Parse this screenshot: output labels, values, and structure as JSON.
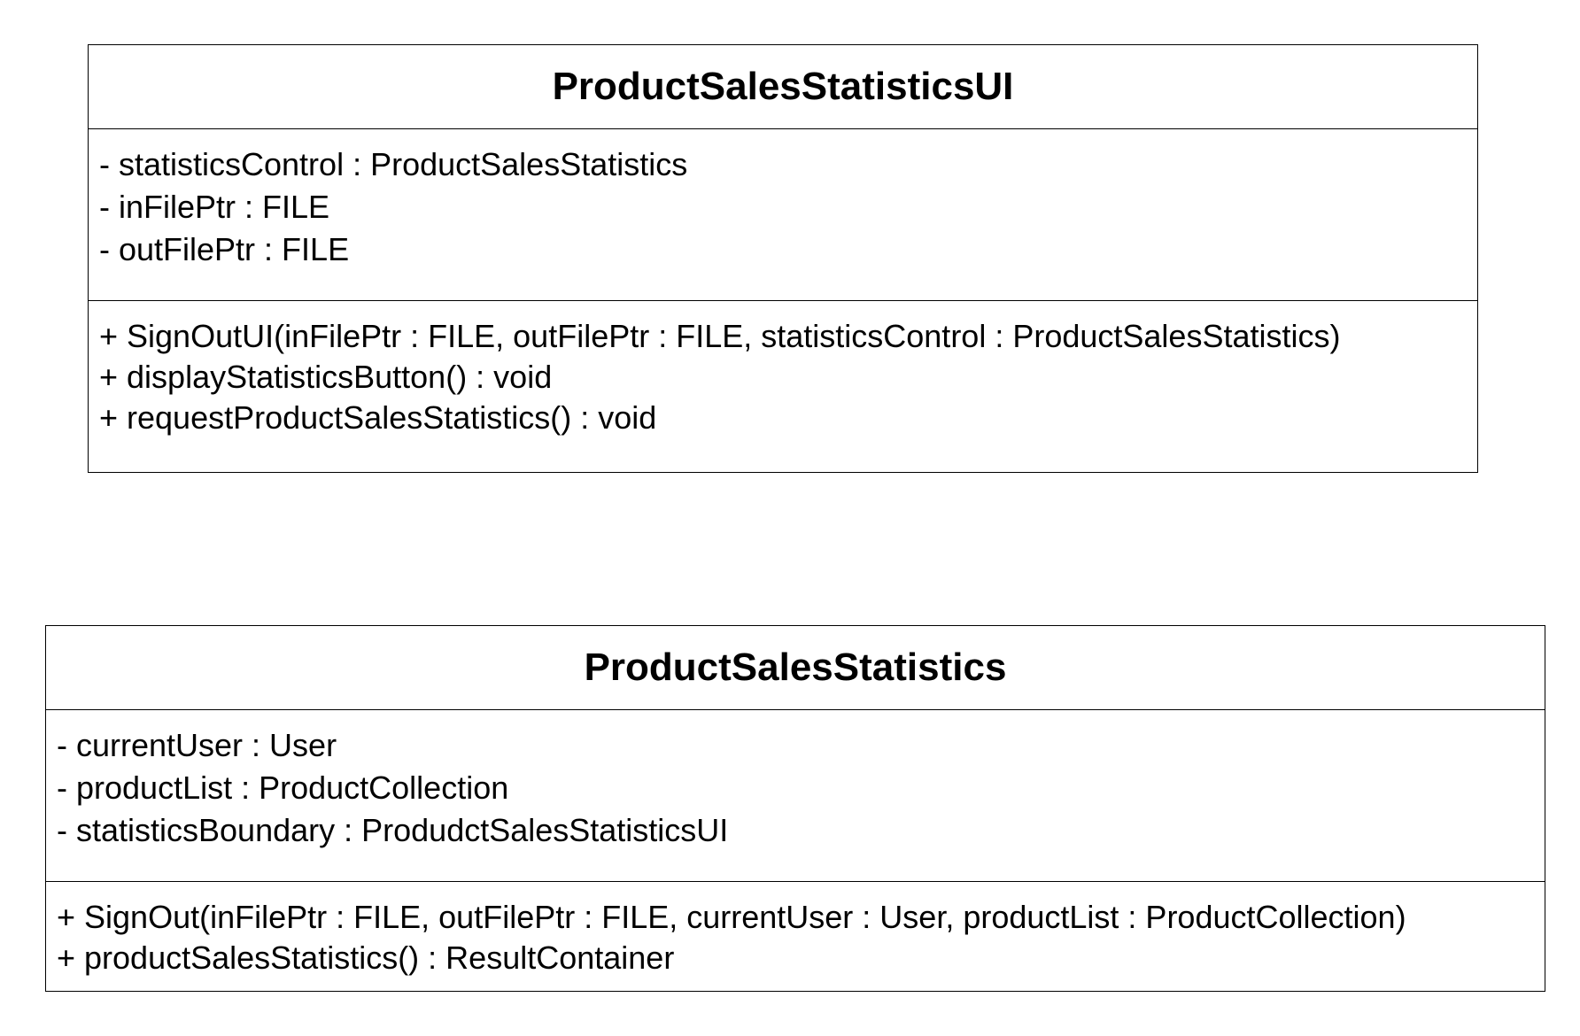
{
  "classes": [
    {
      "name": "ProductSalesStatisticsUI",
      "attributes": [
        "- statisticsControl : ProductSalesStatistics",
        "- inFilePtr : FILE",
        "- outFilePtr : FILE"
      ],
      "operations": [
        "+ SignOutUI(inFilePtr : FILE, outFilePtr : FILE, statisticsControl : ProductSalesStatistics)",
        "+ displayStatisticsButton() : void",
        "+ requestProductSalesStatistics() : void"
      ]
    },
    {
      "name": "ProductSalesStatistics",
      "attributes": [
        "- currentUser : User",
        "- productList : ProductCollection",
        "- statisticsBoundary : ProdudctSalesStatisticsUI"
      ],
      "operations": [
        "+ SignOut(inFilePtr : FILE, outFilePtr : FILE, currentUser : User, productList : ProductCollection)",
        "+ productSalesStatistics() : ResultContainer"
      ]
    }
  ],
  "colors": {
    "border": "#000000",
    "text": "#000000",
    "background": "#ffffff"
  }
}
